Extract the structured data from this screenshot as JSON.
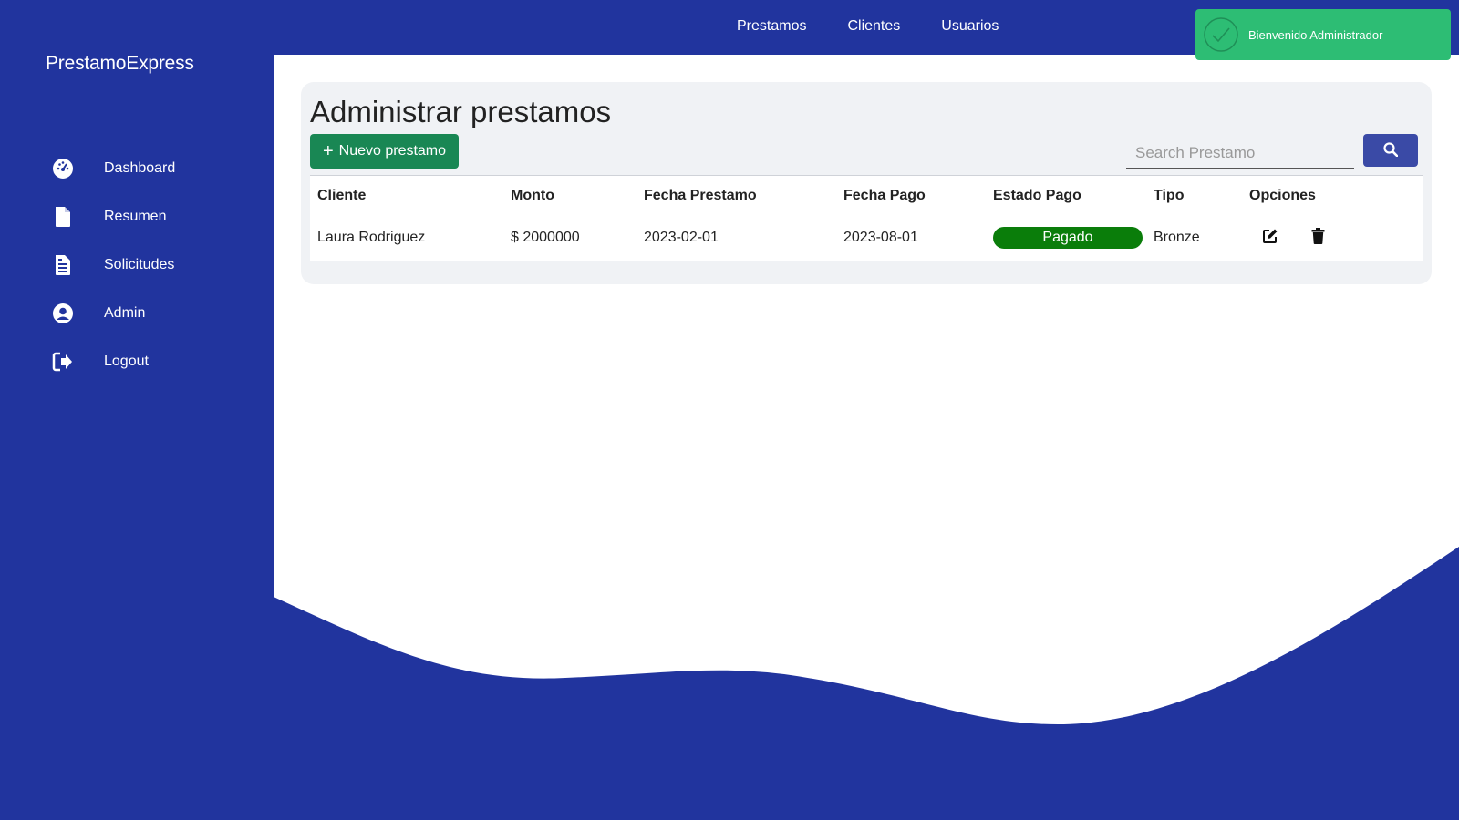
{
  "brand": "PrestamoExpress",
  "sidebar": {
    "items": [
      {
        "label": "Dashboard",
        "icon": "dashboard-gauge-icon"
      },
      {
        "label": "Resumen",
        "icon": "file-icon"
      },
      {
        "label": "Solicitudes",
        "icon": "file-list-icon"
      },
      {
        "label": "Admin",
        "icon": "user-circle-icon"
      },
      {
        "label": "Logout",
        "icon": "sign-out-icon"
      }
    ]
  },
  "topnav": {
    "items": [
      "Prestamos",
      "Clientes",
      "Usuarios"
    ]
  },
  "toast": {
    "message": "Bienvenido Administrador",
    "color": "#2dbd74"
  },
  "main": {
    "title": "Administrar prestamos",
    "new_button": "Nuevo prestamo",
    "search_placeholder": "Search Prestamo",
    "table": {
      "columns": [
        "Cliente",
        "Monto",
        "Fecha Prestamo",
        "Fecha Pago",
        "Estado Pago",
        "Tipo",
        "Opciones"
      ],
      "rows": [
        {
          "cliente": "Laura Rodriguez",
          "monto": "$ 2000000",
          "fecha_prestamo": "2023-02-01",
          "fecha_pago": "2023-08-01",
          "estado_pago": "Pagado",
          "tipo": "Bronze"
        }
      ]
    }
  },
  "colors": {
    "primary_blue": "#21349e",
    "success_green": "#198754",
    "badge_green": "#0a7d0a",
    "search_button": "#3a4aa6"
  }
}
